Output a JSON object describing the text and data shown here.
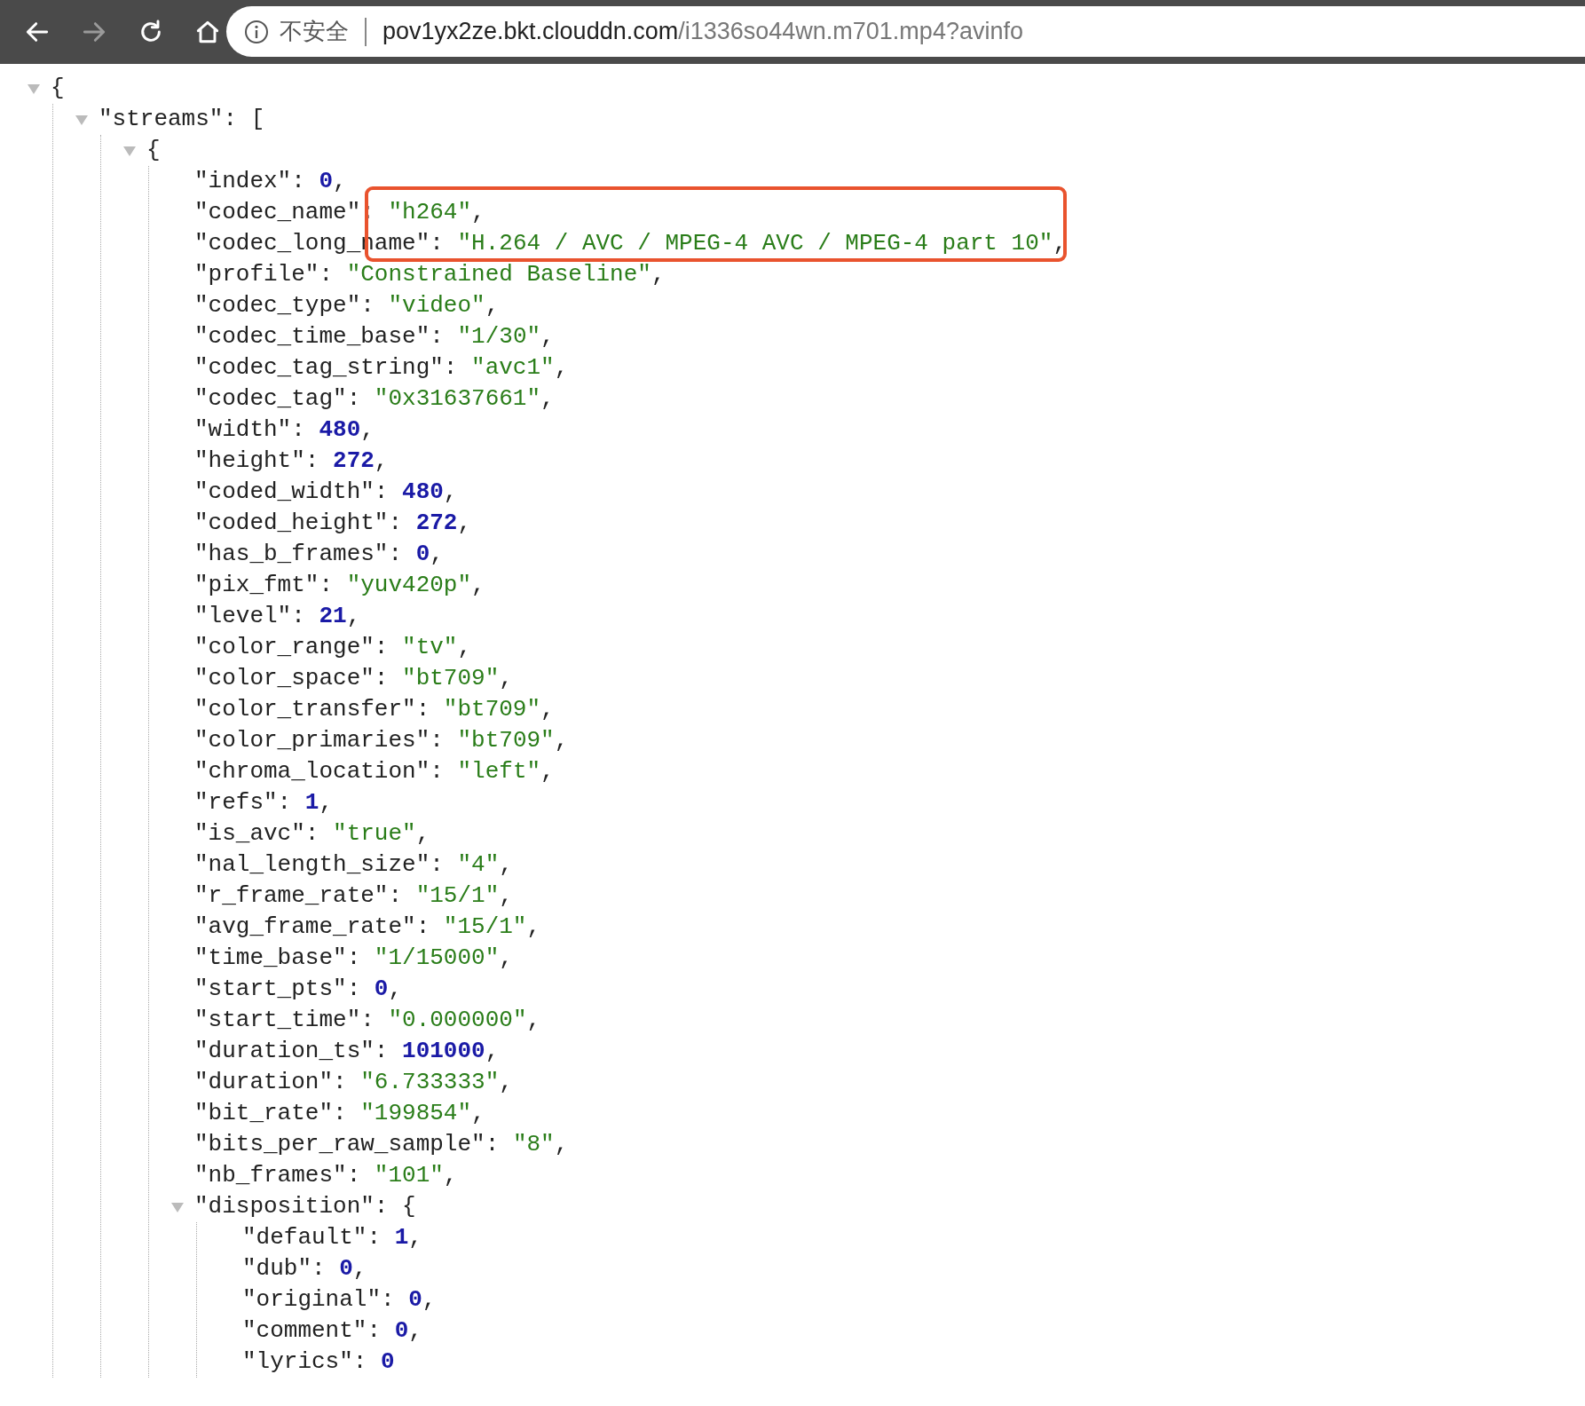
{
  "toolbar": {
    "nav": [
      {
        "kind": "back",
        "disabled": false
      },
      {
        "kind": "forward",
        "disabled": true
      },
      {
        "kind": "reload",
        "disabled": false
      },
      {
        "kind": "home",
        "disabled": false
      }
    ],
    "address": {
      "security_label": "不安全",
      "host": "pov1yx2ze.bkt.clouddn.com",
      "path": "/i1336so44wn.m701.mp4?avinfo"
    }
  },
  "annotation": {
    "kind": "box",
    "color": "#e9532e"
  },
  "json_tree": {
    "open": "{",
    "expanded": true,
    "children": [
      {
        "key": "\"streams\":",
        "open": "[",
        "expanded": true,
        "children": [
          {
            "open": "{",
            "expanded": true,
            "children": [
              {
                "key": "\"index\":",
                "value": "0",
                "kind": "number",
                "punct": ","
              },
              {
                "key": "\"codec_name\":",
                "value": "\"h264\"",
                "kind": "string",
                "punct": ","
              },
              {
                "key": "\"codec_long_name\":",
                "value": "\"H.264 / AVC / MPEG-4 AVC / MPEG-4 part 10\"",
                "kind": "string",
                "punct": ","
              },
              {
                "key": "\"profile\":",
                "value": "\"Constrained Baseline\"",
                "kind": "string",
                "punct": ","
              },
              {
                "key": "\"codec_type\":",
                "value": "\"video\"",
                "kind": "string",
                "punct": ","
              },
              {
                "key": "\"codec_time_base\":",
                "value": "\"1/30\"",
                "kind": "string",
                "punct": ","
              },
              {
                "key": "\"codec_tag_string\":",
                "value": "\"avc1\"",
                "kind": "string",
                "punct": ","
              },
              {
                "key": "\"codec_tag\":",
                "value": "\"0x31637661\"",
                "kind": "string",
                "punct": ","
              },
              {
                "key": "\"width\":",
                "value": "480",
                "kind": "number",
                "punct": ","
              },
              {
                "key": "\"height\":",
                "value": "272",
                "kind": "number",
                "punct": ","
              },
              {
                "key": "\"coded_width\":",
                "value": "480",
                "kind": "number",
                "punct": ","
              },
              {
                "key": "\"coded_height\":",
                "value": "272",
                "kind": "number",
                "punct": ","
              },
              {
                "key": "\"has_b_frames\":",
                "value": "0",
                "kind": "number",
                "punct": ","
              },
              {
                "key": "\"pix_fmt\":",
                "value": "\"yuv420p\"",
                "kind": "string",
                "punct": ","
              },
              {
                "key": "\"level\":",
                "value": "21",
                "kind": "number",
                "punct": ","
              },
              {
                "key": "\"color_range\":",
                "value": "\"tv\"",
                "kind": "string",
                "punct": ","
              },
              {
                "key": "\"color_space\":",
                "value": "\"bt709\"",
                "kind": "string",
                "punct": ","
              },
              {
                "key": "\"color_transfer\":",
                "value": "\"bt709\"",
                "kind": "string",
                "punct": ","
              },
              {
                "key": "\"color_primaries\":",
                "value": "\"bt709\"",
                "kind": "string",
                "punct": ","
              },
              {
                "key": "\"chroma_location\":",
                "value": "\"left\"",
                "kind": "string",
                "punct": ","
              },
              {
                "key": "\"refs\":",
                "value": "1",
                "kind": "number",
                "punct": ","
              },
              {
                "key": "\"is_avc\":",
                "value": "\"true\"",
                "kind": "string",
                "punct": ","
              },
              {
                "key": "\"nal_length_size\":",
                "value": "\"4\"",
                "kind": "string",
                "punct": ","
              },
              {
                "key": "\"r_frame_rate\":",
                "value": "\"15/1\"",
                "kind": "string",
                "punct": ","
              },
              {
                "key": "\"avg_frame_rate\":",
                "value": "\"15/1\"",
                "kind": "string",
                "punct": ","
              },
              {
                "key": "\"time_base\":",
                "value": "\"1/15000\"",
                "kind": "string",
                "punct": ","
              },
              {
                "key": "\"start_pts\":",
                "value": "0",
                "kind": "number",
                "punct": ","
              },
              {
                "key": "\"start_time\":",
                "value": "\"0.000000\"",
                "kind": "string",
                "punct": ","
              },
              {
                "key": "\"duration_ts\":",
                "value": "101000",
                "kind": "number",
                "punct": ","
              },
              {
                "key": "\"duration\":",
                "value": "\"6.733333\"",
                "kind": "string",
                "punct": ","
              },
              {
                "key": "\"bit_rate\":",
                "value": "\"199854\"",
                "kind": "string",
                "punct": ","
              },
              {
                "key": "\"bits_per_raw_sample\":",
                "value": "\"8\"",
                "kind": "string",
                "punct": ","
              },
              {
                "key": "\"nb_frames\":",
                "value": "\"101\"",
                "kind": "string",
                "punct": ","
              },
              {
                "key": "\"disposition\":",
                "open": "{",
                "expanded": true,
                "children": [
                  {
                    "key": "\"default\":",
                    "value": "1",
                    "kind": "number",
                    "punct": ","
                  },
                  {
                    "key": "\"dub\":",
                    "value": "0",
                    "kind": "number",
                    "punct": ","
                  },
                  {
                    "key": "\"original\":",
                    "value": "0",
                    "kind": "number",
                    "punct": ","
                  },
                  {
                    "key": "\"comment\":",
                    "value": "0",
                    "kind": "number",
                    "punct": ","
                  },
                  {
                    "key": "\"lyrics\":",
                    "value": "0",
                    "kind": "number"
                  }
                ]
              }
            ]
          }
        ]
      }
    ]
  }
}
